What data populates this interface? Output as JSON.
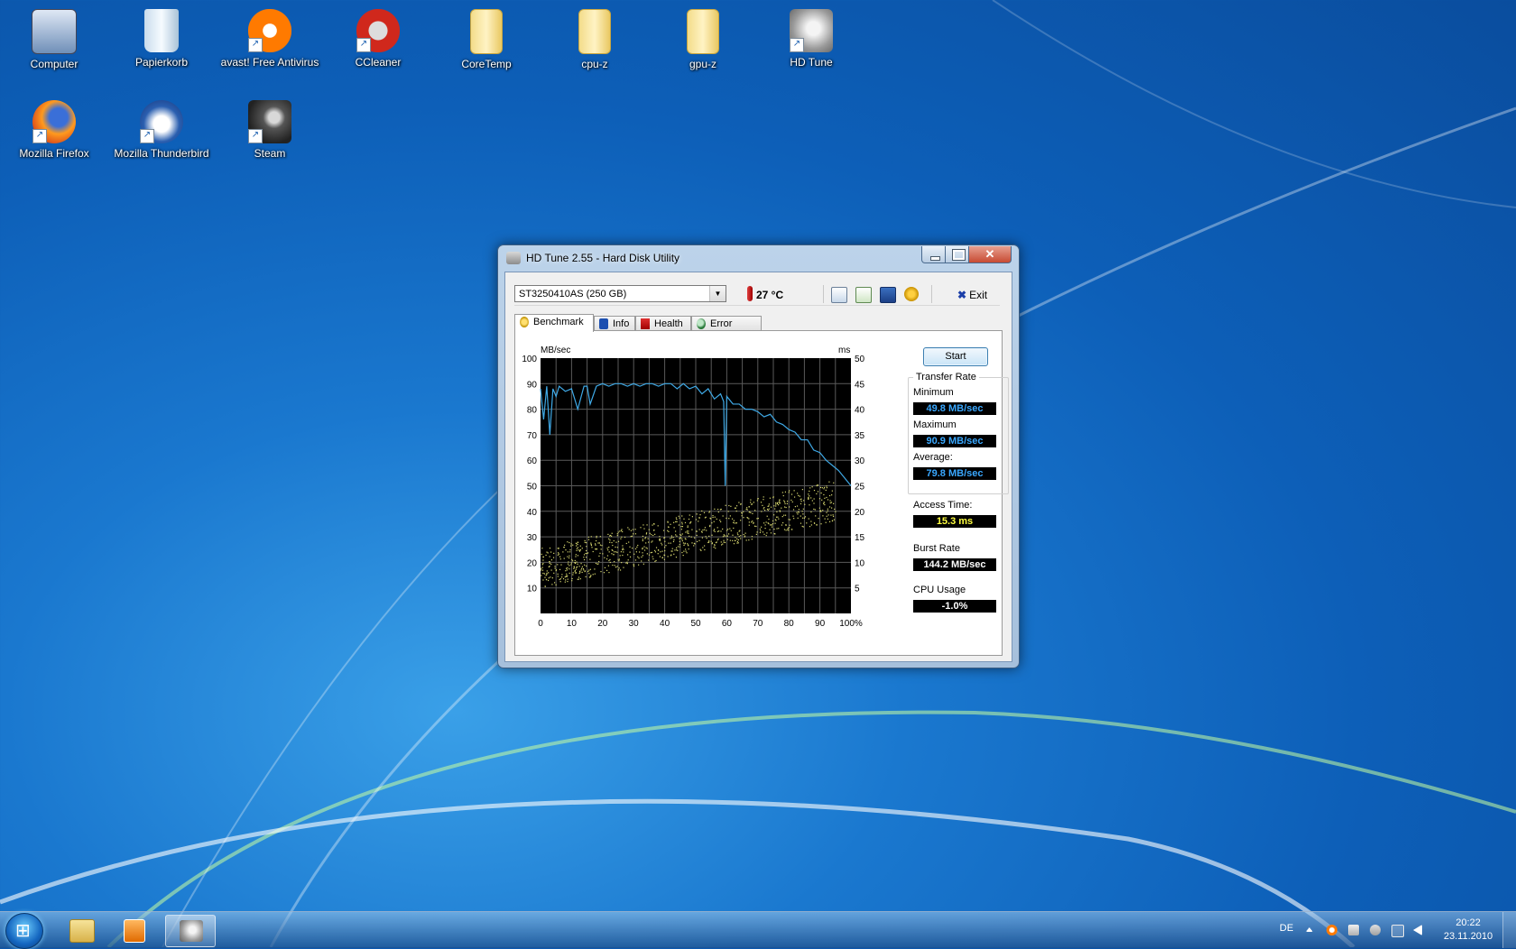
{
  "desktop": {
    "icons": [
      {
        "label": "Computer",
        "icon": "computer-icon"
      },
      {
        "label": "Papierkorb",
        "icon": "recycle-bin-icon"
      },
      {
        "label": "avast! Free Antivirus",
        "icon": "avast-icon"
      },
      {
        "label": "CCleaner",
        "icon": "ccleaner-icon"
      },
      {
        "label": "CoreTemp",
        "icon": "folder-icon"
      },
      {
        "label": "cpu-z",
        "icon": "folder-icon"
      },
      {
        "label": "gpu-z",
        "icon": "folder-icon"
      },
      {
        "label": "HD Tune",
        "icon": "hdtune-icon"
      },
      {
        "label": "Mozilla Firefox",
        "icon": "firefox-icon"
      },
      {
        "label": "Mozilla Thunderbird",
        "icon": "thunderbird-icon"
      },
      {
        "label": "Steam",
        "icon": "steam-icon"
      }
    ]
  },
  "window": {
    "title": "HD Tune 2.55 - Hard Disk Utility",
    "close_glyph": "✕",
    "drive": "ST3250410AS (250 GB)",
    "drive_arrow": "▼",
    "temperature": "27 °C",
    "exit_label": "Exit",
    "exit_glyph": "✖",
    "tabs": [
      "Benchmark",
      "Info",
      "Health",
      "Error Scan"
    ],
    "start_label": "Start",
    "stats": {
      "transfer_rate_title": "Transfer Rate",
      "minimum_label": "Minimum",
      "minimum_value": "49.8 MB/sec",
      "maximum_label": "Maximum",
      "maximum_value": "90.9 MB/sec",
      "average_label": "Average:",
      "average_value": "79.8 MB/sec",
      "access_label": "Access Time:",
      "access_value": "15.3 ms",
      "burst_label": "Burst Rate",
      "burst_value": "144.2 MB/sec",
      "cpu_label": "CPU Usage",
      "cpu_value": "-1.0%"
    }
  },
  "chart_data": {
    "type": "line",
    "xlabel": "",
    "y_left_label": "MB/sec",
    "y_right_label": "ms",
    "xlim": [
      0,
      100
    ],
    "ylim": [
      0,
      100
    ],
    "y2lim": [
      0,
      50
    ],
    "x_ticks": [
      "0",
      "10",
      "20",
      "30",
      "40",
      "50",
      "60",
      "70",
      "80",
      "90",
      "100%"
    ],
    "y_ticks": [
      "10",
      "20",
      "30",
      "40",
      "50",
      "60",
      "70",
      "80",
      "90",
      "100"
    ],
    "y2_ticks": [
      "5",
      "10",
      "15",
      "20",
      "25",
      "30",
      "35",
      "40",
      "45",
      "50"
    ],
    "grid": true,
    "series": [
      {
        "kind": "transfer_rate",
        "color": "#3fa9e6",
        "x": [
          0,
          1,
          2,
          3,
          4,
          5,
          6,
          8,
          10,
          12,
          14,
          15,
          16,
          18,
          20,
          22,
          24,
          26,
          28,
          30,
          32,
          34,
          36,
          38,
          40,
          42,
          44,
          46,
          48,
          50,
          52,
          54,
          56,
          58,
          59,
          59.5,
          60,
          62,
          64,
          66,
          68,
          70,
          72,
          74,
          76,
          78,
          80,
          82,
          84,
          86,
          88,
          90,
          92,
          94,
          96,
          98,
          100
        ],
        "y": [
          88,
          76,
          89,
          70,
          88,
          85,
          89,
          87,
          88,
          80,
          89,
          89,
          82,
          89,
          90,
          89,
          90,
          90,
          89,
          90,
          89,
          90,
          90,
          89,
          90,
          90,
          88,
          90,
          88,
          89,
          86,
          88,
          84,
          86,
          83,
          50,
          85,
          82,
          82,
          80,
          80,
          79,
          77,
          78,
          75,
          74,
          72,
          71,
          68,
          68,
          64,
          63,
          60,
          58,
          56,
          53,
          50
        ]
      },
      {
        "kind": "access_time_scatter",
        "color": "#d8d870",
        "x_range": [
          0,
          95
        ],
        "y2_trend_start": 9,
        "y2_trend_end": 23,
        "y2_spread": 8
      }
    ]
  },
  "taskbar": {
    "items": [
      "explorer-icon",
      "media-player-icon",
      "hdtune-icon"
    ],
    "language": "DE",
    "time": "20:22",
    "date": "23.11.2010",
    "tray_icons": [
      "show-hidden-icons",
      "avast-tray-icon",
      "action-center-icon",
      "safely-remove-icon",
      "network-icon",
      "volume-icon"
    ]
  }
}
